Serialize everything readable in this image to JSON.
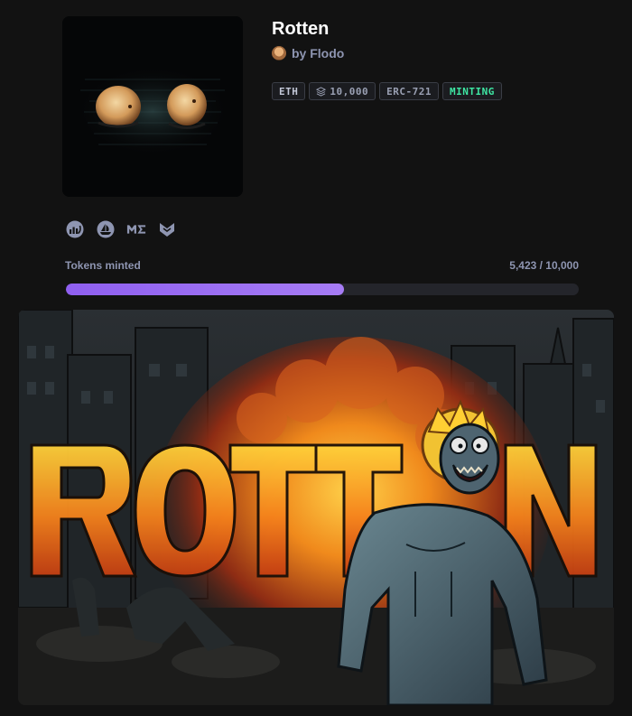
{
  "collection": {
    "name": "Rotten",
    "creator": "by Flodo"
  },
  "chips": {
    "chain": "ETH",
    "supply": "10,000",
    "standard": "ERC-721",
    "status": "MINTING"
  },
  "links": [
    "website-icon",
    "opensea-icon",
    "magiceden-icon",
    "looksrare-icon"
  ],
  "mint": {
    "label": "Tokens minted",
    "count_text": "5,423 / 10,000",
    "minted": 5423,
    "total": 10000
  },
  "colors": {
    "background": "#121212",
    "accent": "#9b6bf2",
    "status": "#3ee6a3",
    "muted_text": "#8e95b1"
  }
}
